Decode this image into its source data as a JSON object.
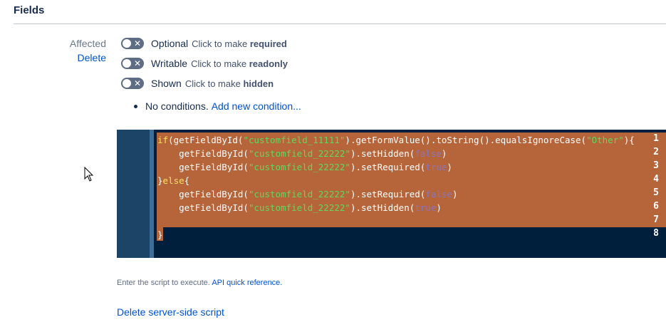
{
  "section": {
    "title": "Fields"
  },
  "field": {
    "name": "Affected",
    "delete_label": "Delete"
  },
  "toggles": [
    {
      "label": "Optional",
      "hint_prefix": "Click to make",
      "hint_strong": "required",
      "state": "off"
    },
    {
      "label": "Writable",
      "hint_prefix": "Click to make",
      "hint_strong": "readonly",
      "state": "off"
    },
    {
      "label": "Shown",
      "hint_prefix": "Click to make",
      "hint_strong": "hidden",
      "state": "off"
    }
  ],
  "conditions": {
    "text": "No conditions.",
    "add_link": "Add new condition..."
  },
  "editor": {
    "lines": [
      {
        "n": "1",
        "parts": [
          [
            "kw",
            "if"
          ],
          [
            "",
            "(getFieldById("
          ],
          [
            "str",
            "\"customfield_11111\""
          ],
          [
            "",
            ").getFormValue().toString().equalsIgnoreCase("
          ],
          [
            "str",
            "\"Other\""
          ],
          [
            "",
            "){"
          ]
        ]
      },
      {
        "n": "2",
        "parts": [
          [
            "",
            "    getFieldById("
          ],
          [
            "str",
            "\"customfield_22222\""
          ],
          [
            "",
            ").setHidden("
          ],
          [
            "lit",
            "false"
          ],
          [
            "",
            ")"
          ]
        ]
      },
      {
        "n": "3",
        "parts": [
          [
            "",
            "    getFieldById("
          ],
          [
            "str",
            "\"customfield_22222\""
          ],
          [
            "",
            ").setRequired("
          ],
          [
            "lit",
            "true"
          ],
          [
            "",
            ")"
          ]
        ]
      },
      {
        "n": "4",
        "parts": [
          [
            "",
            "}"
          ],
          [
            "kw",
            "else"
          ],
          [
            "",
            "{"
          ]
        ]
      },
      {
        "n": "5",
        "parts": [
          [
            "",
            "    getFieldById("
          ],
          [
            "str",
            "\"customfield_22222\""
          ],
          [
            "",
            ").setRequired("
          ],
          [
            "lit",
            "false"
          ],
          [
            "",
            ")"
          ]
        ]
      },
      {
        "n": "6",
        "parts": [
          [
            "",
            "    getFieldById("
          ],
          [
            "str",
            "\"customfield_22222\""
          ],
          [
            "",
            ").setHidden("
          ],
          [
            "lit",
            "true"
          ],
          [
            "",
            ")"
          ]
        ]
      },
      {
        "n": "7",
        "parts": []
      },
      {
        "n": "8",
        "parts": [
          [
            "",
            "}"
          ]
        ]
      }
    ]
  },
  "help": {
    "text": "Enter the script to execute.",
    "link": "API quick reference."
  },
  "delete_script": {
    "label": "Delete server-side script"
  },
  "colors": {
    "selection": "#b6653a",
    "editor_bg": "#001f3d",
    "gutter_bg": "#1b4466",
    "link": "#0052cc"
  }
}
